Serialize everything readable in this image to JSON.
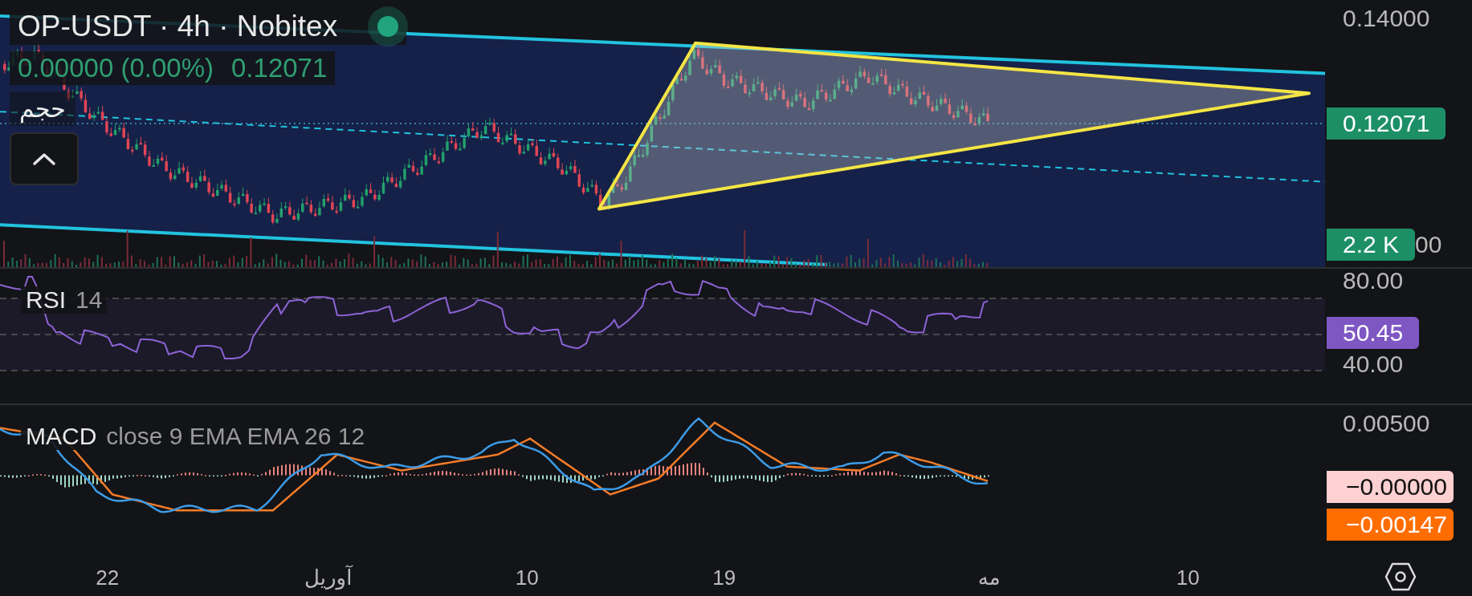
{
  "header": {
    "symbol_line": "OP-USDT · 4h · Nobitex",
    "live": true,
    "change": "0.00000 (0.00%)",
    "last": "0.12071",
    "volume_label": "حجم"
  },
  "price_axis": {
    "ticks": [
      "0.14000",
      "00"
    ],
    "last_badge": "0.12071",
    "volume_badge": "2.2 K"
  },
  "rsi": {
    "title": "RSI",
    "params": "14",
    "ticks": [
      "80.00",
      "40.00"
    ],
    "badge": "50.45"
  },
  "macd": {
    "title": "MACD",
    "params": "close 9 EMA EMA 26 12",
    "ticks": [
      "0.00500"
    ],
    "badges": [
      {
        "text": "−0.00000",
        "color": "#fdd0d1"
      },
      {
        "text": "−0.00147",
        "color": "#ff6d00"
      }
    ]
  },
  "time_axis": [
    "22",
    "آوریل",
    "10",
    "19",
    "مه",
    "10"
  ]
}
